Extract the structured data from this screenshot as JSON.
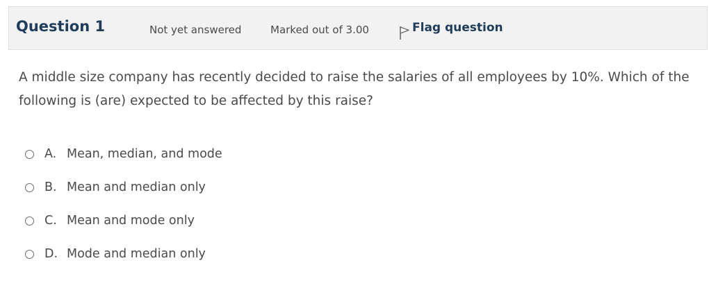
{
  "info": {
    "title": "Question 1",
    "state": "Not yet answered",
    "grade": "Marked out of 3.00",
    "flag_label": "Flag question",
    "flag_icon": "flag-icon"
  },
  "question": {
    "text": "A middle size company has recently decided to raise the salaries of all employees by 10%. Which of the following is (are) expected to be affected by this raise?"
  },
  "answers": [
    {
      "letter": "A.",
      "text": "Mean, median, and mode"
    },
    {
      "letter": "B.",
      "text": "Mean and median only"
    },
    {
      "letter": "C.",
      "text": "Mean and mode only"
    },
    {
      "letter": "D.",
      "text": "Mode and median only"
    }
  ]
}
